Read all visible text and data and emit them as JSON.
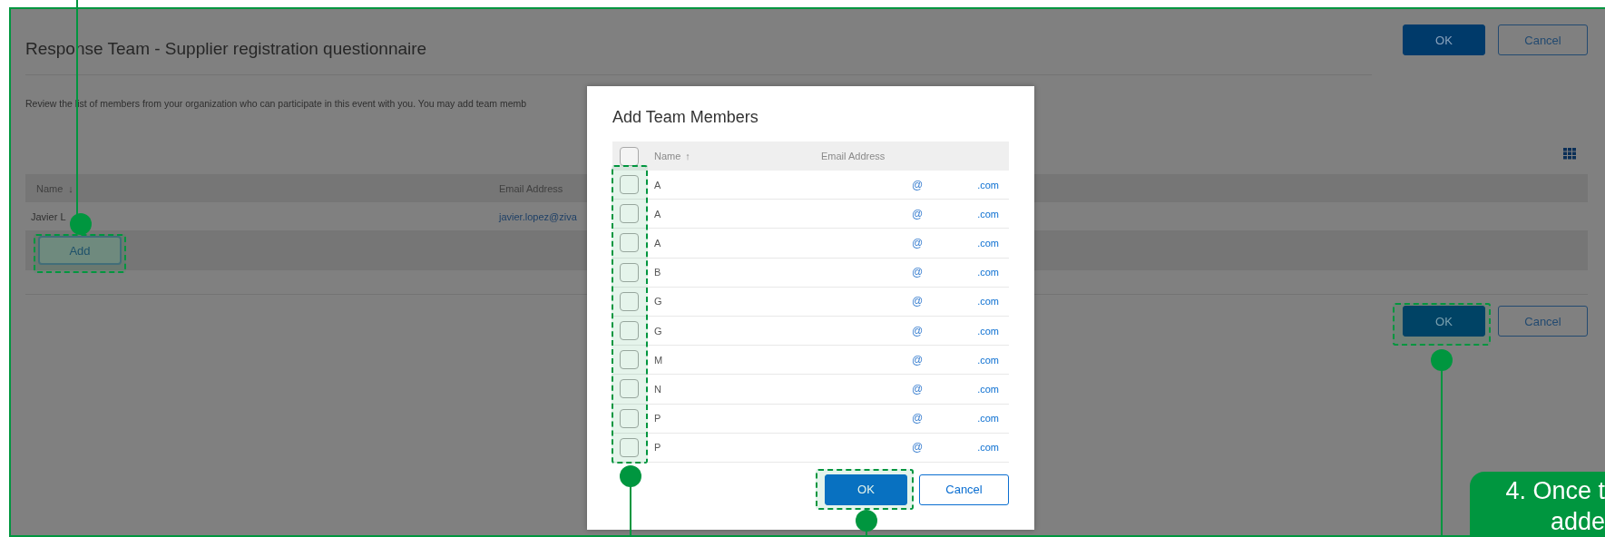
{
  "page": {
    "title": "Response Team - Supplier registration questionnaire",
    "header_buttons": [
      {
        "label": "OK",
        "kind": "primary"
      },
      {
        "label": "Cancel",
        "kind": "secondary"
      }
    ],
    "description": "Review the list of members from your organization who can participate in this event with you. You may add team memb",
    "table": {
      "columns": [
        {
          "label": "Name",
          "sort_mark": "↓"
        },
        {
          "label": "Email Address"
        }
      ],
      "rows": [
        {
          "name": "Javier L",
          "email": "javier.lopez@ziva"
        }
      ],
      "add_button": "Add"
    },
    "footer_buttons": [
      {
        "label": "OK",
        "kind": "primary"
      },
      {
        "label": "Cancel",
        "kind": "secondary"
      }
    ]
  },
  "dialog": {
    "title": "Add Team Members",
    "select_all": {
      "checked": false
    },
    "columns": [
      {
        "label": "Name",
        "sort_mark": "↑"
      },
      {
        "label": "Email Address"
      }
    ],
    "rows": [
      {
        "name": "A",
        "email_at": "@",
        "email_domain": ".com",
        "checked": false
      },
      {
        "name": "A",
        "email_at": "@",
        "email_domain": ".com",
        "checked": false
      },
      {
        "name": "A",
        "email_at": "@",
        "email_domain": ".com",
        "checked": false
      },
      {
        "name": "B",
        "email_at": "@",
        "email_domain": ".com",
        "checked": false
      },
      {
        "name": "G",
        "email_at": "@",
        "email_domain": ".com",
        "checked": false
      },
      {
        "name": "G",
        "email_at": "@",
        "email_domain": ".com",
        "checked": false
      },
      {
        "name": "M",
        "email_at": "@",
        "email_domain": ".com",
        "checked": false
      },
      {
        "name": "N",
        "email_at": "@",
        "email_domain": ".com",
        "checked": false
      },
      {
        "name": "P",
        "email_at": "@",
        "email_domain": ".com",
        "checked": false
      },
      {
        "name": "P",
        "email_at": "@",
        "email_domain": ".com",
        "checked": false
      }
    ],
    "buttons": [
      {
        "label": "OK",
        "kind": "primary"
      },
      {
        "label": "Cancel",
        "kind": "secondary"
      }
    ]
  },
  "callout": {
    "lines": [
      "4. Once t",
      "adde"
    ]
  }
}
